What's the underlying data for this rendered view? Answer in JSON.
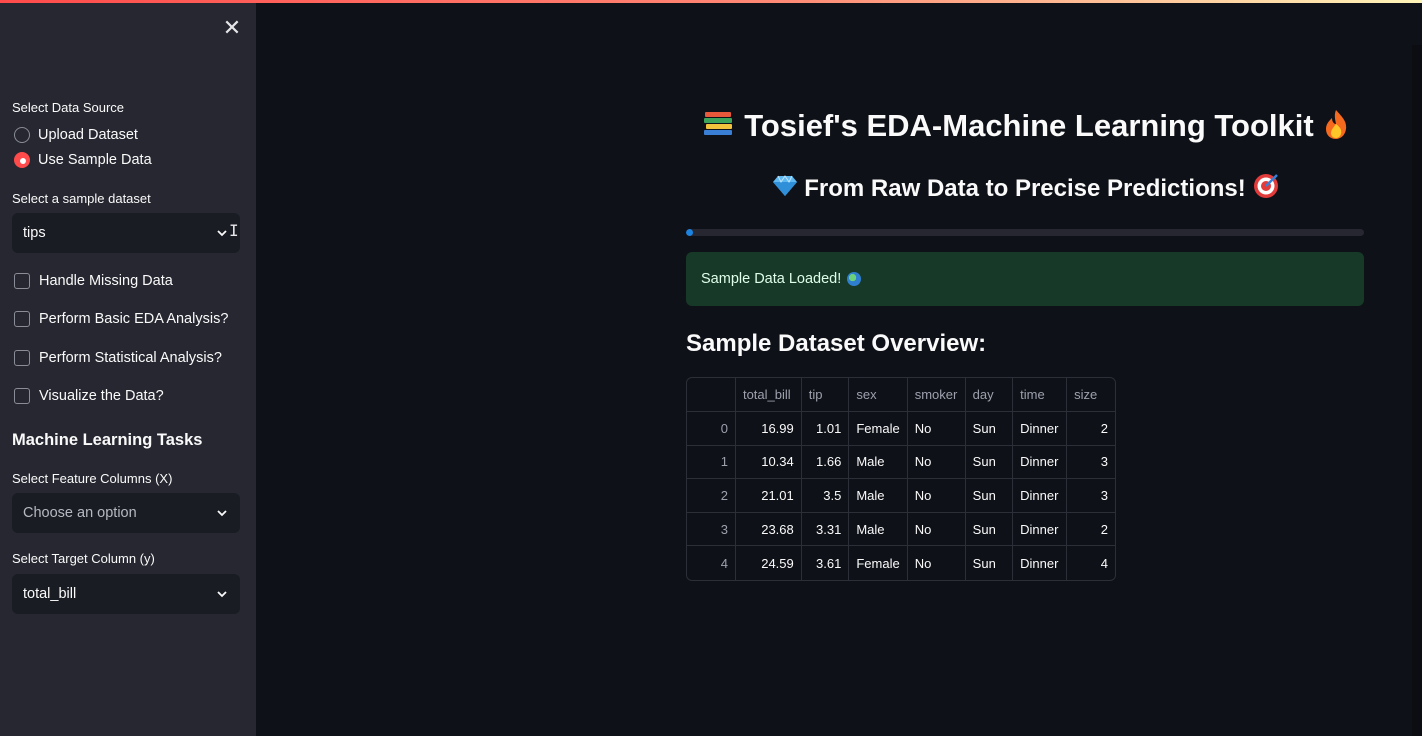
{
  "sidebar": {
    "close_icon": "close-icon",
    "data_source_label": "Select Data Source",
    "radio_options": [
      {
        "label": "Upload Dataset",
        "selected": false
      },
      {
        "label": "Use Sample Data",
        "selected": true
      }
    ],
    "sample_dataset_label": "Select a sample dataset",
    "sample_dataset_value": "tips",
    "checkboxes": [
      {
        "label": "Handle Missing Data",
        "checked": false
      },
      {
        "label": "Perform Basic EDA Analysis?",
        "checked": false
      },
      {
        "label": "Perform Statistical Analysis?",
        "checked": false
      },
      {
        "label": "Visualize the Data?",
        "checked": false
      }
    ],
    "ml_heading": "Machine Learning Tasks",
    "feature_label": "Select Feature Columns (X)",
    "feature_placeholder": "Choose an option",
    "target_label": "Select Target Column (y)",
    "target_value": "total_bill"
  },
  "main": {
    "title": "Tosief's EDA-Machine Learning Toolkit",
    "title_icons": [
      "books-emoji",
      "fire-emoji"
    ],
    "subtitle": "From Raw Data to Precise Predictions!",
    "subtitle_icons": [
      "gem-emoji",
      "target-emoji"
    ],
    "progress_percent": 1,
    "alert_text": "Sample Data Loaded!",
    "alert_icon": "globe-emoji",
    "section_title": "Sample Dataset Overview:"
  },
  "table": {
    "columns": [
      "",
      "total_bill",
      "tip",
      "sex",
      "smoker",
      "day",
      "time",
      "size"
    ],
    "rows": [
      [
        "0",
        "16.99",
        "1.01",
        "Female",
        "No",
        "Sun",
        "Dinner",
        "2"
      ],
      [
        "1",
        "10.34",
        "1.66",
        "Male",
        "No",
        "Sun",
        "Dinner",
        "3"
      ],
      [
        "2",
        "21.01",
        "3.5",
        "Male",
        "No",
        "Sun",
        "Dinner",
        "3"
      ],
      [
        "3",
        "23.68",
        "3.31",
        "Male",
        "No",
        "Sun",
        "Dinner",
        "2"
      ],
      [
        "4",
        "24.59",
        "3.61",
        "Female",
        "No",
        "Sun",
        "Dinner",
        "4"
      ]
    ]
  },
  "colors": {
    "accent": "#ff4b4b",
    "progress": "#1c83e1",
    "success_bg": "#173928",
    "background": "#0e1117",
    "sidebar_bg": "#262730"
  }
}
